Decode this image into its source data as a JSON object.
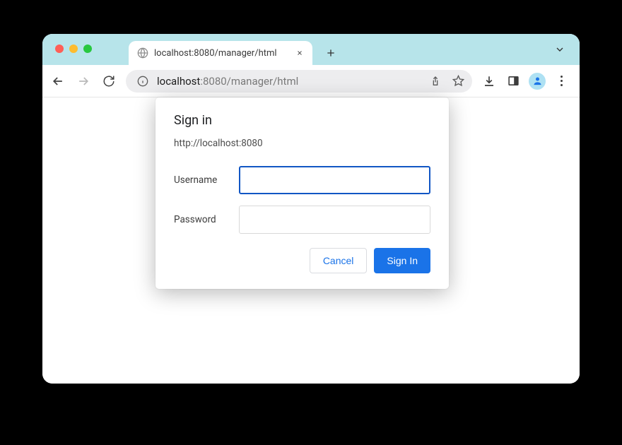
{
  "tab": {
    "title": "localhost:8080/manager/html"
  },
  "omnibox": {
    "host": "localhost",
    "path": ":8080/manager/html"
  },
  "dialog": {
    "title": "Sign in",
    "origin": "http://localhost:8080",
    "username_label": "Username",
    "password_label": "Password",
    "username_value": "",
    "password_value": "",
    "cancel_label": "Cancel",
    "signin_label": "Sign In"
  }
}
